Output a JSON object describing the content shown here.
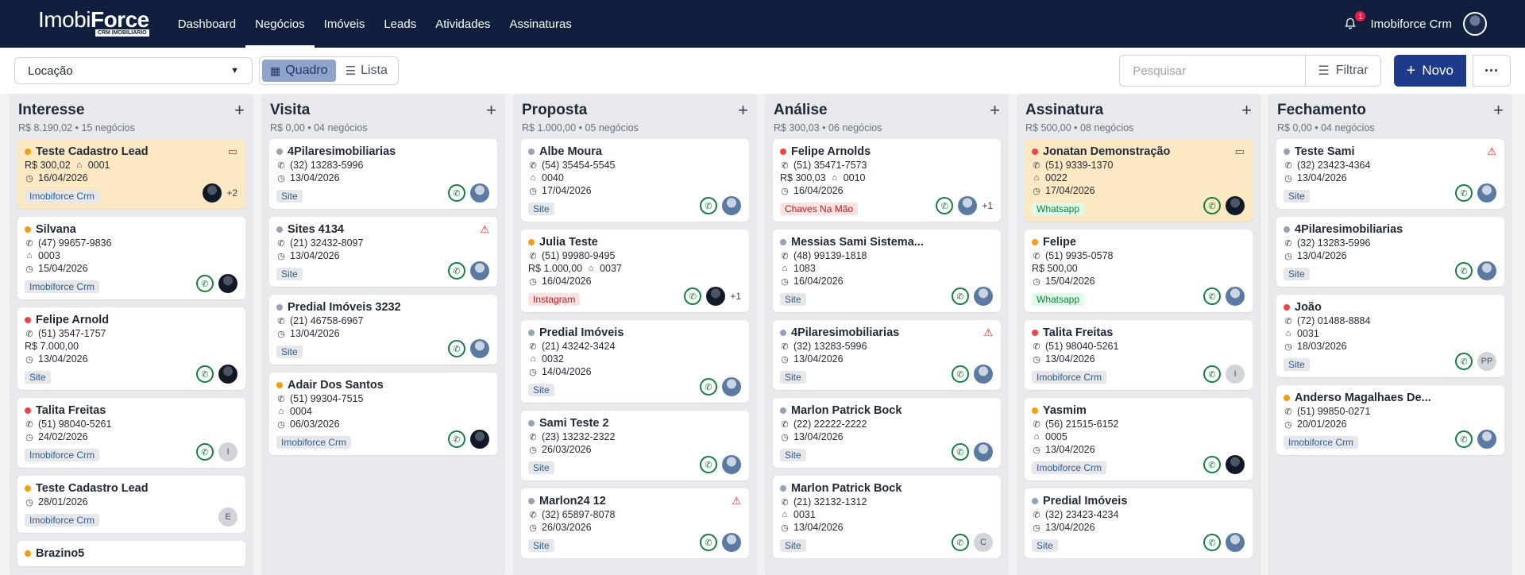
{
  "app": {
    "brand_a": "Imobi",
    "brand_b": "Force",
    "brand_sub": "CRM IMOBILIÁRIO"
  },
  "nav": [
    {
      "label": "Dashboard"
    },
    {
      "label": "Negócios"
    },
    {
      "label": "Imóveis"
    },
    {
      "label": "Leads"
    },
    {
      "label": "Atividades"
    },
    {
      "label": "Assinaturas"
    }
  ],
  "user": {
    "name": "Imobiforce Crm",
    "notifications": "1"
  },
  "toolbar": {
    "pipeline": "Locação",
    "view_board": "Quadro",
    "view_list": "Lista",
    "search_placeholder": "Pesquisar",
    "filter": "Filtrar",
    "new": "Novo"
  },
  "colors": {
    "yellow": "#f59e0b",
    "red": "#ef4444",
    "gray": "#94a3b8",
    "highlight": "#fde8c4"
  },
  "columns": [
    {
      "title": "Interesse",
      "total": "R$ 8.190,02",
      "count": "15 negócios",
      "cards": [
        {
          "name": "Teste Cadastro Lead",
          "dot": "yellow",
          "hl": true,
          "flag": "chat",
          "lines": [
            {
              "icon": "money",
              "text": "R$ 300,02",
              "extra": "0001"
            },
            {
              "icon": "clock",
              "text": "16/04/2026"
            }
          ],
          "tag": "Imobiforce Crm",
          "tagtype": "gray",
          "wa": false,
          "avatar": "dark",
          "more": "+2"
        },
        {
          "name": "Silvana",
          "dot": "yellow",
          "lines": [
            {
              "icon": "phone",
              "text": "(47) 99657-9836"
            },
            {
              "icon": "home",
              "text": "0003"
            },
            {
              "icon": "clock",
              "text": "15/04/2026"
            }
          ],
          "tag": "Imobiforce Crm",
          "tagtype": "gray",
          "wa": true,
          "avatar": "dark"
        },
        {
          "name": "Felipe Arnold",
          "dot": "red",
          "lines": [
            {
              "icon": "phone",
              "text": "(51) 3547-1757"
            },
            {
              "icon": "none",
              "text": "R$ 7.000,00"
            },
            {
              "icon": "clock",
              "text": "13/04/2026"
            }
          ],
          "tag": "Site",
          "tagtype": "gray",
          "wa": true,
          "avatar": "dark"
        },
        {
          "name": "Talita Freitas",
          "dot": "red",
          "lines": [
            {
              "icon": "phone",
              "text": "(51) 98040-5261"
            },
            {
              "icon": "clock",
              "text": "24/02/2026"
            }
          ],
          "tag": "Imobiforce Crm",
          "tagtype": "gray",
          "wa": true,
          "avatar": "letter",
          "avatar_text": "I"
        },
        {
          "name": "Teste Cadastro Lead",
          "dot": "yellow",
          "lines": [
            {
              "icon": "clock",
              "text": "28/01/2026"
            }
          ],
          "tag": "Imobiforce Crm",
          "tagtype": "gray",
          "wa": false,
          "avatar": "letter",
          "avatar_text": "E"
        },
        {
          "name": "Brazino5",
          "dot": "yellow",
          "lines": [],
          "tag": "",
          "wa": false,
          "avatar": ""
        }
      ]
    },
    {
      "title": "Visita",
      "total": "R$ 0,00",
      "count": "04 negócios",
      "cards": [
        {
          "name": "4Pilaresimobiliarias",
          "dot": "gray",
          "lines": [
            {
              "icon": "phone",
              "text": "(32) 13283-5996"
            },
            {
              "icon": "clock",
              "text": "13/04/2026"
            }
          ],
          "tag": "Site",
          "tagtype": "gray",
          "wa": true,
          "avatar": "photo"
        },
        {
          "name": "Sites 4134",
          "dot": "gray",
          "flag": "warn",
          "lines": [
            {
              "icon": "phone",
              "text": "(21) 32432-8097"
            },
            {
              "icon": "clock",
              "text": "13/04/2026"
            }
          ],
          "tag": "Site",
          "tagtype": "gray",
          "wa": true,
          "avatar": "photo"
        },
        {
          "name": "Predial Imóveis 3232",
          "dot": "gray",
          "lines": [
            {
              "icon": "phone",
              "text": "(21) 46758-6967"
            },
            {
              "icon": "clock",
              "text": "13/04/2026"
            }
          ],
          "tag": "Site",
          "tagtype": "gray",
          "wa": true,
          "avatar": "photo"
        },
        {
          "name": "Adair Dos Santos",
          "dot": "yellow",
          "lines": [
            {
              "icon": "phone",
              "text": "(51) 99304-7515"
            },
            {
              "icon": "home",
              "text": "0004"
            },
            {
              "icon": "clock",
              "text": "06/03/2026"
            }
          ],
          "tag": "Imobiforce Crm",
          "tagtype": "gray",
          "wa": true,
          "avatar": "dark"
        }
      ]
    },
    {
      "title": "Proposta",
      "total": "R$ 1.000,00",
      "count": "05 negócios",
      "cards": [
        {
          "name": "Albe Moura",
          "dot": "gray",
          "lines": [
            {
              "icon": "phone",
              "text": "(54) 35454-5545"
            },
            {
              "icon": "home",
              "text": "0040"
            },
            {
              "icon": "clock",
              "text": "17/04/2026"
            }
          ],
          "tag": "Site",
          "tagtype": "gray",
          "wa": true,
          "avatar": "photo"
        },
        {
          "name": "Julia Teste",
          "dot": "yellow",
          "lines": [
            {
              "icon": "phone",
              "text": "(51) 99980-9495"
            },
            {
              "icon": "none",
              "text": "R$ 1.000,00",
              "extra": "0037"
            },
            {
              "icon": "clock",
              "text": "16/04/2026"
            }
          ],
          "tag": "Instagram",
          "tagtype": "pink",
          "wa": true,
          "avatar": "dark",
          "more": "+1"
        },
        {
          "name": "Predial Imóveis",
          "dot": "gray",
          "lines": [
            {
              "icon": "phone",
              "text": "(21) 43242-3424"
            },
            {
              "icon": "home",
              "text": "0032"
            },
            {
              "icon": "clock",
              "text": "14/04/2026"
            }
          ],
          "tag": "Site",
          "tagtype": "gray",
          "wa": true,
          "avatar": "photo"
        },
        {
          "name": "Sami Teste 2",
          "dot": "gray",
          "lines": [
            {
              "icon": "phone",
              "text": "(23) 13232-2322"
            },
            {
              "icon": "clock",
              "text": "26/03/2026"
            }
          ],
          "tag": "Site",
          "tagtype": "gray",
          "wa": true,
          "avatar": "photo"
        },
        {
          "name": "Marlon24 12",
          "dot": "gray",
          "flag": "warn",
          "lines": [
            {
              "icon": "phone",
              "text": "(32) 65897-8078"
            },
            {
              "icon": "clock",
              "text": "26/03/2026"
            }
          ],
          "tag": "Site",
          "tagtype": "gray",
          "wa": true,
          "avatar": "photo"
        }
      ]
    },
    {
      "title": "Análise",
      "total": "R$ 300,03",
      "count": "06 negócios",
      "cards": [
        {
          "name": "Felipe Arnolds",
          "dot": "red",
          "lines": [
            {
              "icon": "phone",
              "text": "(51) 35471-7573"
            },
            {
              "icon": "none",
              "text": "R$ 300,03",
              "extra": "0010"
            },
            {
              "icon": "clock",
              "text": "16/04/2026"
            }
          ],
          "tag": "Chaves Na Mão",
          "tagtype": "pink",
          "wa": true,
          "avatar": "photo",
          "more": "+1"
        },
        {
          "name": "Messias Sami Sistema...",
          "dot": "gray",
          "lines": [
            {
              "icon": "phone",
              "text": "(48) 99139-1818"
            },
            {
              "icon": "home",
              "text": "1083"
            },
            {
              "icon": "clock",
              "text": "16/04/2026"
            }
          ],
          "tag": "Site",
          "tagtype": "gray",
          "wa": true,
          "avatar": "photo"
        },
        {
          "name": "4Pilaresimobiliarias",
          "dot": "gray",
          "flag": "warn",
          "lines": [
            {
              "icon": "phone",
              "text": "(32) 13283-5996"
            },
            {
              "icon": "clock",
              "text": "13/04/2026"
            }
          ],
          "tag": "Site",
          "tagtype": "gray",
          "wa": true,
          "avatar": "photo"
        },
        {
          "name": "Marlon Patrick Bock",
          "dot": "gray",
          "lines": [
            {
              "icon": "phone",
              "text": "(22) 22222-2222"
            },
            {
              "icon": "clock",
              "text": "13/04/2026"
            }
          ],
          "tag": "Site",
          "tagtype": "gray",
          "wa": true,
          "avatar": "photo"
        },
        {
          "name": "Marlon Patrick Bock",
          "dot": "gray",
          "lines": [
            {
              "icon": "phone",
              "text": "(21) 32132-1312"
            },
            {
              "icon": "home",
              "text": "0031"
            },
            {
              "icon": "clock",
              "text": "13/04/2026"
            }
          ],
          "tag": "Site",
          "tagtype": "gray",
          "wa": true,
          "avatar": "letter",
          "avatar_text": "C"
        }
      ]
    },
    {
      "title": "Assinatura",
      "total": "R$ 500,00",
      "count": "08 negócios",
      "cards": [
        {
          "name": "Jonatan Demonstração",
          "dot": "red",
          "hl": true,
          "flag": "chat",
          "lines": [
            {
              "icon": "phone",
              "text": "(51) 9339-1370"
            },
            {
              "icon": "home",
              "text": "0022"
            },
            {
              "icon": "clock",
              "text": "17/04/2026"
            }
          ],
          "tag": "Whatsapp",
          "tagtype": "green",
          "wa": true,
          "avatar": "dark"
        },
        {
          "name": "Felipe",
          "dot": "yellow",
          "lines": [
            {
              "icon": "phone",
              "text": "(51) 9935-0578"
            },
            {
              "icon": "none",
              "text": "R$ 500,00"
            },
            {
              "icon": "clock",
              "text": "15/04/2026"
            }
          ],
          "tag": "Whatsapp",
          "tagtype": "green",
          "wa": true,
          "avatar": "photo"
        },
        {
          "name": "Talita Freitas",
          "dot": "red",
          "lines": [
            {
              "icon": "phone",
              "text": "(51) 98040-5261"
            },
            {
              "icon": "clock",
              "text": "13/04/2026"
            }
          ],
          "tag": "Imobiforce Crm",
          "tagtype": "gray",
          "wa": true,
          "avatar": "letter",
          "avatar_text": "I"
        },
        {
          "name": "Yasmim",
          "dot": "yellow",
          "lines": [
            {
              "icon": "phone",
              "text": "(56) 21515-6152"
            },
            {
              "icon": "home",
              "text": "0005"
            },
            {
              "icon": "clock",
              "text": "13/04/2026"
            }
          ],
          "tag": "Imobiforce Crm",
          "tagtype": "gray",
          "wa": true,
          "avatar": "dark"
        },
        {
          "name": "Predial Imóveis",
          "dot": "gray",
          "lines": [
            {
              "icon": "phone",
              "text": "(32) 23423-4234"
            },
            {
              "icon": "clock",
              "text": "13/04/2026"
            }
          ],
          "tag": "Site",
          "tagtype": "gray",
          "wa": true,
          "avatar": "photo"
        }
      ]
    },
    {
      "title": "Fechamento",
      "total": "R$ 0,00",
      "count": "04 negócios",
      "cards": [
        {
          "name": "Teste Sami",
          "dot": "gray",
          "flag": "warn",
          "lines": [
            {
              "icon": "phone",
              "text": "(32) 23423-4364"
            },
            {
              "icon": "clock",
              "text": "13/04/2026"
            }
          ],
          "tag": "Site",
          "tagtype": "gray",
          "wa": true,
          "avatar": "photo"
        },
        {
          "name": "4Pilaresimobiliarias",
          "dot": "gray",
          "lines": [
            {
              "icon": "phone",
              "text": "(32) 13283-5996"
            },
            {
              "icon": "clock",
              "text": "13/04/2026"
            }
          ],
          "tag": "Site",
          "tagtype": "gray",
          "wa": true,
          "avatar": "photo"
        },
        {
          "name": "João",
          "dot": "red",
          "lines": [
            {
              "icon": "phone",
              "text": "(72) 01488-8884"
            },
            {
              "icon": "home",
              "text": "0031"
            },
            {
              "icon": "clock",
              "text": "18/03/2026"
            }
          ],
          "tag": "Site",
          "tagtype": "gray",
          "wa": true,
          "avatar": "letter",
          "avatar_text": "PP"
        },
        {
          "name": "Anderso Magalhaes De...",
          "dot": "yellow",
          "lines": [
            {
              "icon": "phone",
              "text": "(51) 99850-0271"
            },
            {
              "icon": "clock",
              "text": "20/01/2026"
            }
          ],
          "tag": "Imobiforce Crm",
          "tagtype": "gray",
          "wa": true,
          "avatar": "photo"
        }
      ]
    }
  ]
}
